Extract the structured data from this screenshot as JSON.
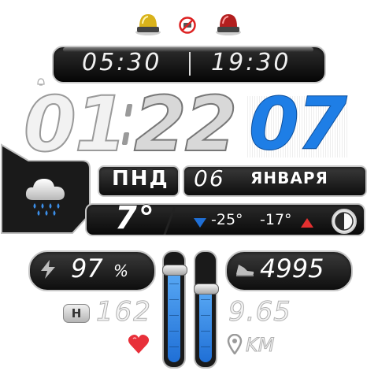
{
  "alarms": {
    "left_icon": "alarm-lamp-yellow-icon",
    "center_icon": "do-not-disturb-icon",
    "right_icon": "alarm-lamp-red-icon"
  },
  "sun": {
    "sunrise": "05:30",
    "sunset": "19:30"
  },
  "time": {
    "hours": "01",
    "minutes": "22",
    "seconds": "07"
  },
  "date": {
    "weekday": "ПНД",
    "day": "06",
    "month": "ЯНВАРЯ"
  },
  "weather": {
    "icon": "rain-cloud-icon",
    "temperature": "7°",
    "min_temp": "-25°",
    "max_temp": "-17°",
    "moon_icon": "moon-phase-icon"
  },
  "battery": {
    "icon": "lightning-icon",
    "value": "97",
    "unit": "%",
    "level": 0.97
  },
  "steps": {
    "icon": "shoe-icon",
    "value": "4995"
  },
  "heart": {
    "badge": "H",
    "value": "162",
    "icon": "heart-icon"
  },
  "distance": {
    "value": "9.65",
    "unit": "KM",
    "icon": "location-pin-icon"
  },
  "sliders": {
    "left_level": 0.88,
    "right_level": 0.7
  },
  "colors": {
    "accent": "#1e7ee6",
    "panel": "#141414",
    "heart": "#e8303a",
    "min_arrow": "#1f6fd6",
    "max_arrow": "#e43030"
  }
}
